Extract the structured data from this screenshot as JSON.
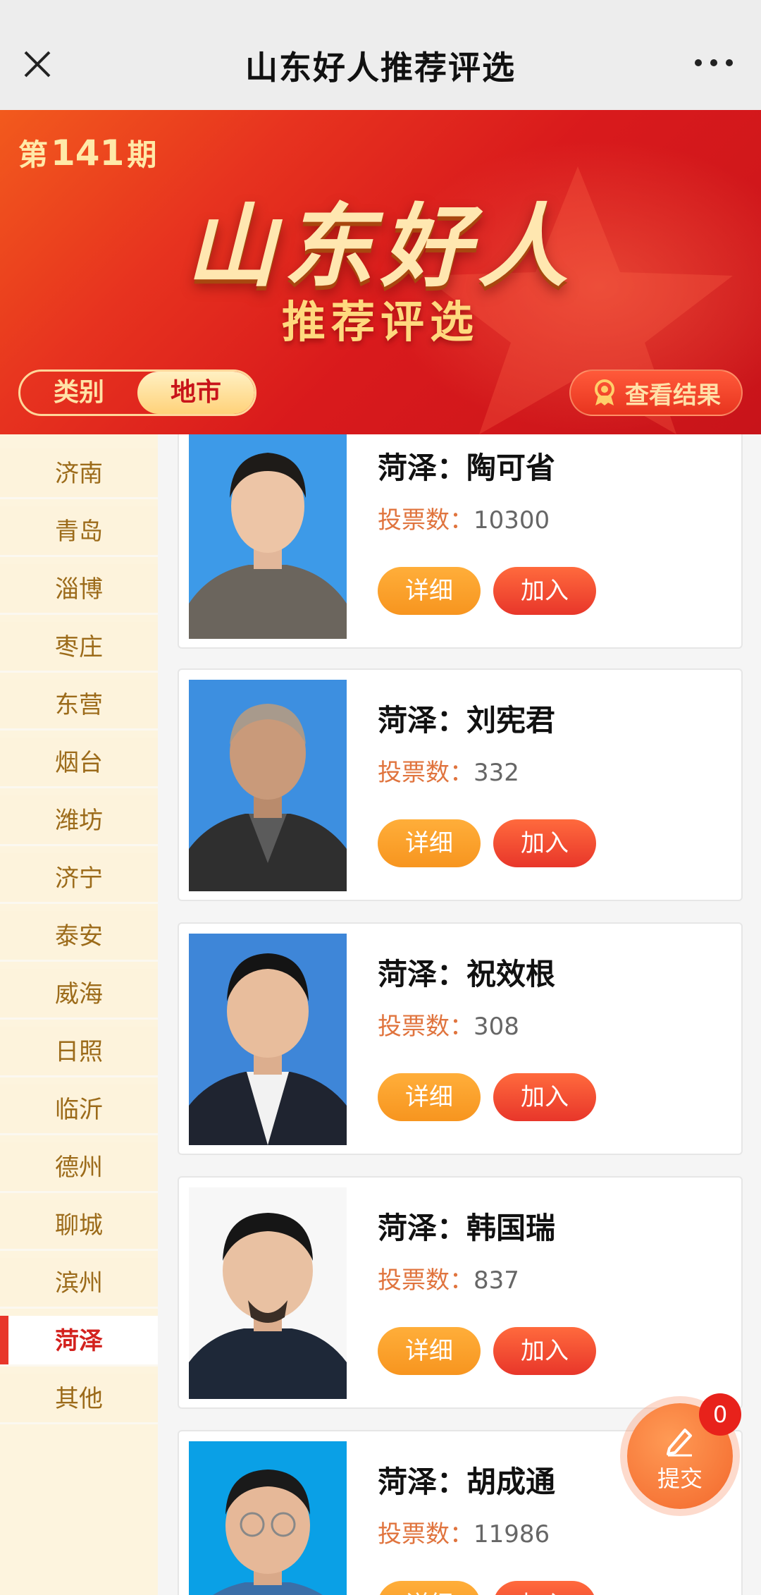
{
  "topbar": {
    "title": "山东好人推荐评选"
  },
  "banner": {
    "issue_prefix": "第",
    "issue_number": "141",
    "issue_suffix": "期",
    "title": "山东好人",
    "subtitle": "推荐评选",
    "tabs": [
      {
        "label": "类别",
        "active": false
      },
      {
        "label": "地市",
        "active": true
      }
    ],
    "result_button": "查看结果"
  },
  "sidebar": {
    "cities": [
      "济南",
      "青岛",
      "淄博",
      "枣庄",
      "东营",
      "烟台",
      "潍坊",
      "济宁",
      "泰安",
      "威海",
      "日照",
      "临沂",
      "德州",
      "聊城",
      "滨州",
      "菏泽",
      "其他"
    ],
    "active": "菏泽"
  },
  "candidates": [
    {
      "name": "菏泽：陶可省",
      "votes_label": "投票数：",
      "votes": "10300",
      "detail": "详细",
      "join": "加入"
    },
    {
      "name": "菏泽：刘宪君",
      "votes_label": "投票数：",
      "votes": "332",
      "detail": "详细",
      "join": "加入"
    },
    {
      "name": "菏泽：祝效根",
      "votes_label": "投票数：",
      "votes": "308",
      "detail": "详细",
      "join": "加入"
    },
    {
      "name": "菏泽：韩国瑞",
      "votes_label": "投票数：",
      "votes": "837",
      "detail": "详细",
      "join": "加入"
    },
    {
      "name": "菏泽：胡成通",
      "votes_label": "投票数：",
      "votes": "11986",
      "detail": "详细",
      "join": "加入"
    }
  ],
  "submit": {
    "label": "提交",
    "count": "0"
  },
  "colors": {
    "accent": "#e8362a",
    "banner_red": "#d91a1c",
    "gold": "#ffe7b0",
    "sidebar_bg": "#fdf4de"
  }
}
